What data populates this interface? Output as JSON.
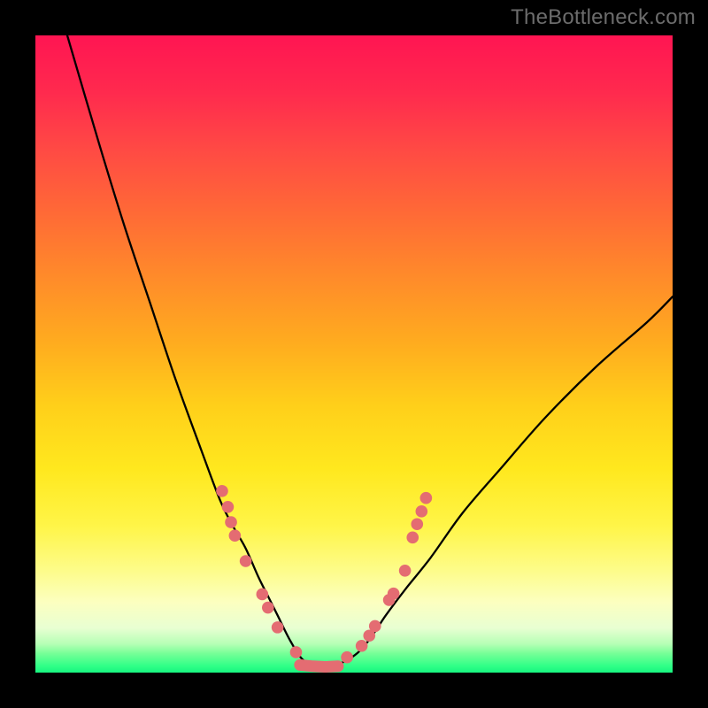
{
  "watermark": "TheBottleneck.com",
  "chart_data": {
    "type": "line",
    "title": "",
    "xlabel": "",
    "ylabel": "",
    "xlim": [
      0,
      100
    ],
    "ylim": [
      0,
      100
    ],
    "series": [
      {
        "name": "curve-left",
        "x": [
          5,
          10,
          14,
          18,
          22,
          26,
          29,
          31,
          33,
          35,
          36.5,
          38,
          40,
          42,
          44.5
        ],
        "y": [
          100,
          83,
          70,
          58,
          46,
          35,
          27,
          23,
          19.5,
          15,
          12,
          9,
          5,
          2,
          0.9
        ]
      },
      {
        "name": "curve-right",
        "x": [
          44.5,
          47,
          49,
          51,
          53,
          55,
          58,
          62,
          67,
          73,
          80,
          88,
          96,
          100
        ],
        "y": [
          0.9,
          1.2,
          2,
          3.5,
          6,
          9,
          13,
          18,
          25,
          32,
          40,
          48,
          55,
          59
        ]
      }
    ],
    "markers": {
      "left_cluster": [
        {
          "x": 29.3,
          "y": 28.5
        },
        {
          "x": 30.2,
          "y": 26.0
        },
        {
          "x": 30.7,
          "y": 23.6
        },
        {
          "x": 31.3,
          "y": 21.5
        },
        {
          "x": 33.0,
          "y": 17.5
        },
        {
          "x": 35.6,
          "y": 12.3
        },
        {
          "x": 36.5,
          "y": 10.2
        },
        {
          "x": 38.0,
          "y": 7.1
        },
        {
          "x": 40.9,
          "y": 3.2
        }
      ],
      "right_cluster": [
        {
          "x": 48.9,
          "y": 2.4
        },
        {
          "x": 51.2,
          "y": 4.2
        },
        {
          "x": 52.4,
          "y": 5.8
        },
        {
          "x": 53.3,
          "y": 7.3
        },
        {
          "x": 55.5,
          "y": 11.4
        },
        {
          "x": 56.2,
          "y": 12.4
        },
        {
          "x": 58.0,
          "y": 16.0
        },
        {
          "x": 59.2,
          "y": 21.2
        },
        {
          "x": 59.9,
          "y": 23.3
        },
        {
          "x": 60.6,
          "y": 25.3
        },
        {
          "x": 61.3,
          "y": 27.4
        }
      ],
      "bottom_band": [
        {
          "x": 41.5,
          "y": 1.2
        },
        {
          "x": 43.5,
          "y": 1.0
        },
        {
          "x": 45.5,
          "y": 0.9
        },
        {
          "x": 47.5,
          "y": 1.0
        }
      ]
    },
    "marker_radius_px": 6.8,
    "colors": {
      "curve": "#000000",
      "marker": "#e46c72"
    }
  }
}
